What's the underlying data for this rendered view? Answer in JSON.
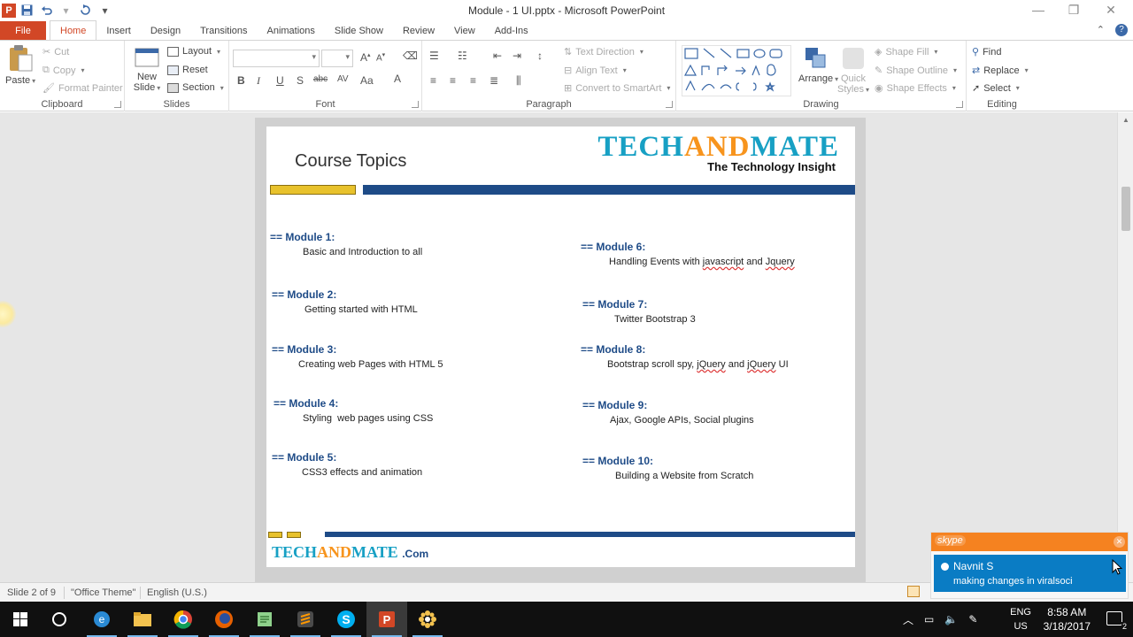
{
  "window": {
    "title": "Module - 1 UI.pptx - Microsoft PowerPoint",
    "controls": [
      "minimize",
      "restore",
      "close"
    ]
  },
  "quick_access": [
    "powerpoint-icon",
    "save-icon",
    "undo-icon",
    "redo-icon",
    "customize-icon"
  ],
  "tabs": [
    {
      "label": "File"
    },
    {
      "label": "Home"
    },
    {
      "label": "Insert"
    },
    {
      "label": "Design"
    },
    {
      "label": "Transitions"
    },
    {
      "label": "Animations"
    },
    {
      "label": "Slide Show"
    },
    {
      "label": "Review"
    },
    {
      "label": "View"
    },
    {
      "label": "Add-Ins"
    }
  ],
  "ribbon": {
    "clipboard": {
      "label": "Clipboard",
      "paste": "Paste",
      "cut": "Cut",
      "copy": "Copy",
      "format_painter": "Format Painter"
    },
    "slides": {
      "label": "Slides",
      "new_slide": "New Slide",
      "new_slide_line1": "New",
      "new_slide_line2": "Slide",
      "layout": "Layout",
      "reset": "Reset",
      "section": "Section"
    },
    "font": {
      "label": "Font",
      "font_name": "",
      "font_size": ""
    },
    "paragraph": {
      "label": "Paragraph",
      "text_direction": "Text Direction",
      "align_text": "Align Text",
      "convert_smartart": "Convert to SmartArt"
    },
    "drawing": {
      "label": "Drawing",
      "arrange": "Arrange",
      "quick_styles": "Quick Styles",
      "quick_line1": "Quick",
      "quick_line2": "Styles",
      "shape_fill": "Shape Fill",
      "shape_outline": "Shape Outline",
      "shape_effects": "Shape Effects"
    },
    "editing": {
      "label": "Editing",
      "find": "Find",
      "replace": "Replace",
      "select": "Select"
    }
  },
  "slide": {
    "title": "Course Topics",
    "brand_name": "TECHANDMATE",
    "brand_tagline": "The Technology Insight",
    "footer_brand": "TECHANDMATE",
    "footer_com": ".Com",
    "modules_left": [
      {
        "title": "== Module 1:",
        "desc": "Basic and Introduction to all"
      },
      {
        "title": "== Module 2:",
        "desc": "Getting started with HTML"
      },
      {
        "title": "== Module 3:",
        "desc": "Creating web Pages with HTML 5"
      },
      {
        "title": "== Module 4:",
        "desc": "Styling  web pages using CSS"
      },
      {
        "title": "== Module 5:",
        "desc": "CSS3 effects and animation"
      }
    ],
    "modules_right": [
      {
        "title": "== Module 6:",
        "desc_pre": "Handling Events with ",
        "desc_sq1": "javascript",
        "desc_mid": " and ",
        "desc_sq2": "Jquery",
        "desc_post": ""
      },
      {
        "title": "== Module 7:",
        "desc": "Twitter Bootstrap 3"
      },
      {
        "title": "== Module 8:",
        "desc_pre": "Bootstrap scroll spy, ",
        "desc_sq1": "jQuery",
        "desc_mid": " and ",
        "desc_sq2": "jQuery",
        "desc_post": " UI"
      },
      {
        "title": "== Module 9:",
        "desc": "Ajax, Google APIs, Social plugins"
      },
      {
        "title": "== Module 10:",
        "desc": "Building a Website from Scratch"
      }
    ]
  },
  "status": {
    "slide_info": "Slide 2 of 9",
    "theme": "\"Office Theme\"",
    "language": "English (U.S.)"
  },
  "skype": {
    "brand": "skype",
    "name": "Navnit S",
    "message": "making changes in viralsoci"
  },
  "taskbar": {
    "apps": [
      "start-icon",
      "cortana-icon",
      "ie-icon",
      "file-explorer-icon",
      "chrome-icon",
      "firefox-icon",
      "notepad-icon",
      "sublime-icon",
      "skype-icon",
      "powerpoint-icon",
      "paint-icon"
    ],
    "lang_line1": "ENG",
    "lang_line2": "US",
    "time": "8:58 AM",
    "date": "3/18/2017",
    "notification_count": "2"
  },
  "colors": {
    "accent": "#d24726",
    "slide_blue": "#1e4b87",
    "slide_yellow": "#e8c22c",
    "brand_teal": "#17a0c4",
    "brand_orange": "#f7941d",
    "skype_orange": "#f58220",
    "skype_blue": "#0a7cc4"
  }
}
